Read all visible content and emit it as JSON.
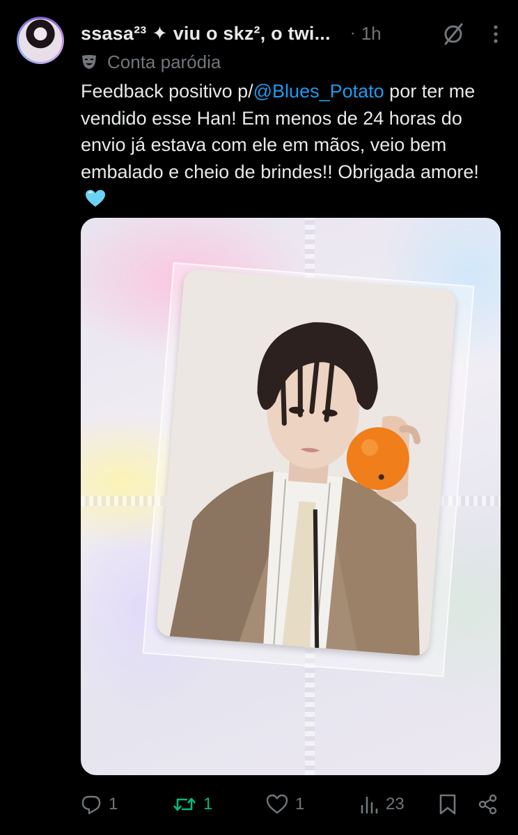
{
  "author": {
    "display_name": "ssasa²³ ✦ viu o skz², o twi...",
    "time_separator": "·",
    "time": "1h",
    "label": "Conta paródia",
    "label_icon": "parody-mask-icon"
  },
  "tweet": {
    "text_prefix": "Feedback positivo p/",
    "mention": "@Blues_Potato",
    "text_suffix": "  por ter me vendido esse Han! Em menos de 24 horas do envio já estava com ele em mãos, veio bem embalado e cheio de brindes!! Obrigada amore! ",
    "emoji": "light-blue-heart-emoji"
  },
  "media": {
    "type": "photo",
    "subject": "photocard in holographic sleeve"
  },
  "actions": {
    "replies": "1",
    "reposts": "1",
    "likes": "1",
    "views": "23"
  },
  "colors": {
    "background": "#000000",
    "text": "#e7e9ea",
    "secondary": "#71767b",
    "link": "#1d9bf0",
    "repost_active": "#00ba7c"
  }
}
